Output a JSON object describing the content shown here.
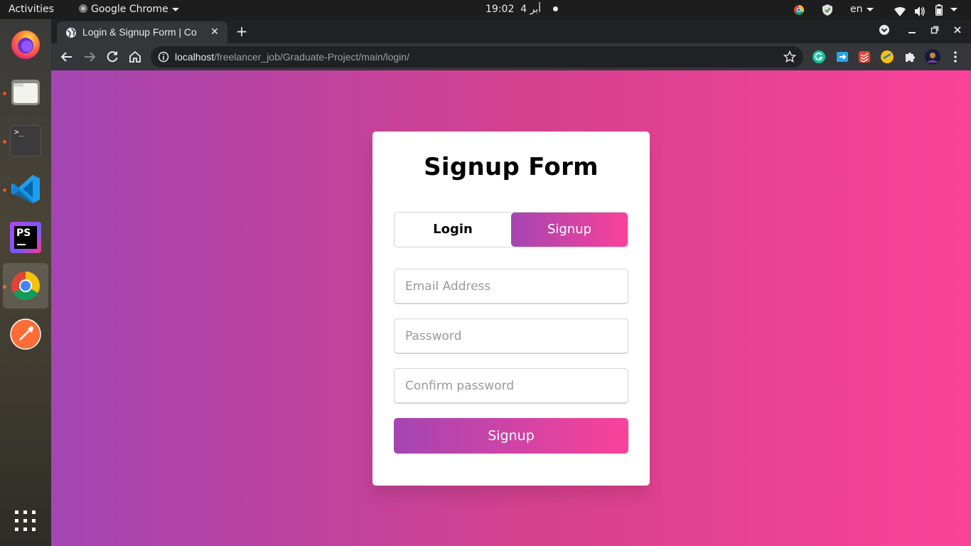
{
  "topbar": {
    "activities": "Activities",
    "app_name": "Google Chrome",
    "date": "أبر 4",
    "time": "19:02",
    "language": "en"
  },
  "dock": {
    "apps": [
      "firefox",
      "files",
      "terminal",
      "vscode",
      "phpstorm",
      "chrome",
      "postman"
    ],
    "terminal_glyph": ">_",
    "phpstorm_glyph": "PS"
  },
  "browser": {
    "tab_title": "Login & Signup Form | Co",
    "url_host": "localhost",
    "url_path": "/freelancer_job/Graduate-Project/main/login/"
  },
  "page": {
    "form_title": "Signup Form",
    "tabs": {
      "login": "Login",
      "signup": "Signup"
    },
    "active_tab": "signup",
    "fields": {
      "email_placeholder": "Email Address",
      "password_placeholder": "Password",
      "confirm_placeholder": "Confirm password"
    },
    "submit_label": "Signup",
    "colors": {
      "gradient_start": "#a445b2",
      "gradient_end": "#fa4299"
    }
  }
}
